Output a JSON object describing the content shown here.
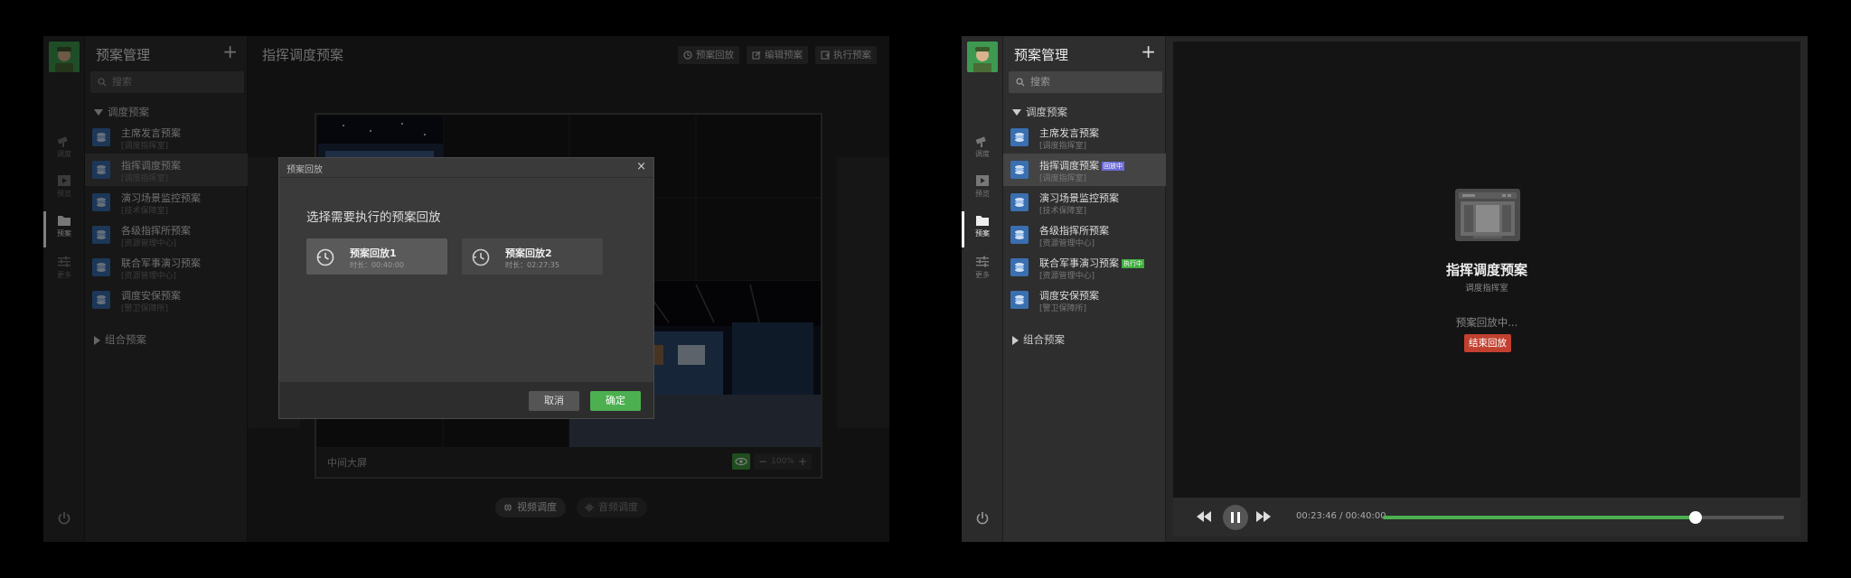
{
  "nav": {
    "items": [
      {
        "label": "调度",
        "icon": "camera-icon"
      },
      {
        "label": "预览",
        "icon": "play-icon"
      },
      {
        "label": "预案",
        "icon": "folder-icon"
      },
      {
        "label": "更多",
        "icon": "sliders-icon"
      }
    ]
  },
  "sidebar": {
    "title": "预案管理",
    "add": "+",
    "search_placeholder": "搜索",
    "group1": "调度预案",
    "group2": "组合预案",
    "plans": [
      {
        "name": "主席发言预案",
        "sub": "[调度指挥室]"
      },
      {
        "name": "指挥调度预案",
        "sub": "[调度指挥室]"
      },
      {
        "name": "演习场景监控预案",
        "sub": "[技术保障室]"
      },
      {
        "name": "各级指挥所预案",
        "sub": "[资源管理中心]"
      },
      {
        "name": "联合军事演习预案",
        "sub": "[资源管理中心]"
      },
      {
        "name": "调度安保预案",
        "sub": "[警卫保障所]"
      }
    ]
  },
  "panelA": {
    "title": "指挥调度预案",
    "toolbar": {
      "playback": "预案回放",
      "edit": "编辑预案",
      "execute": "执行预案"
    },
    "screen_label": "中间大屏",
    "zoom": "100%",
    "zoom_minus": "−",
    "zoom_plus": "+",
    "mode_video": "视频调度",
    "mode_audio": "音频调度",
    "modal": {
      "title": "预案回放",
      "close": "×",
      "question": "选择需要执行的预案回放",
      "options": [
        {
          "name": "预案回放1",
          "duration": "时长：00:40:00"
        },
        {
          "name": "预案回放2",
          "duration": "时长：02:27:35"
        }
      ],
      "cancel": "取消",
      "confirm": "确定"
    }
  },
  "panelB": {
    "badge_playing": "回放中",
    "badge_running": "执行中",
    "title": "指挥调度预案",
    "subtitle": "调度指挥室",
    "status": "预案回放中...",
    "stop": "结束回放",
    "time": "00:23:46 / 00:40:00",
    "progress": 0.78
  },
  "colors": {
    "accent_green": "#4caf50",
    "danger_red": "#c2402f",
    "badge_blue": "#6b6bd6",
    "badge_green": "#3fae3f",
    "plan_icon_blue": "#3a6fb0"
  }
}
